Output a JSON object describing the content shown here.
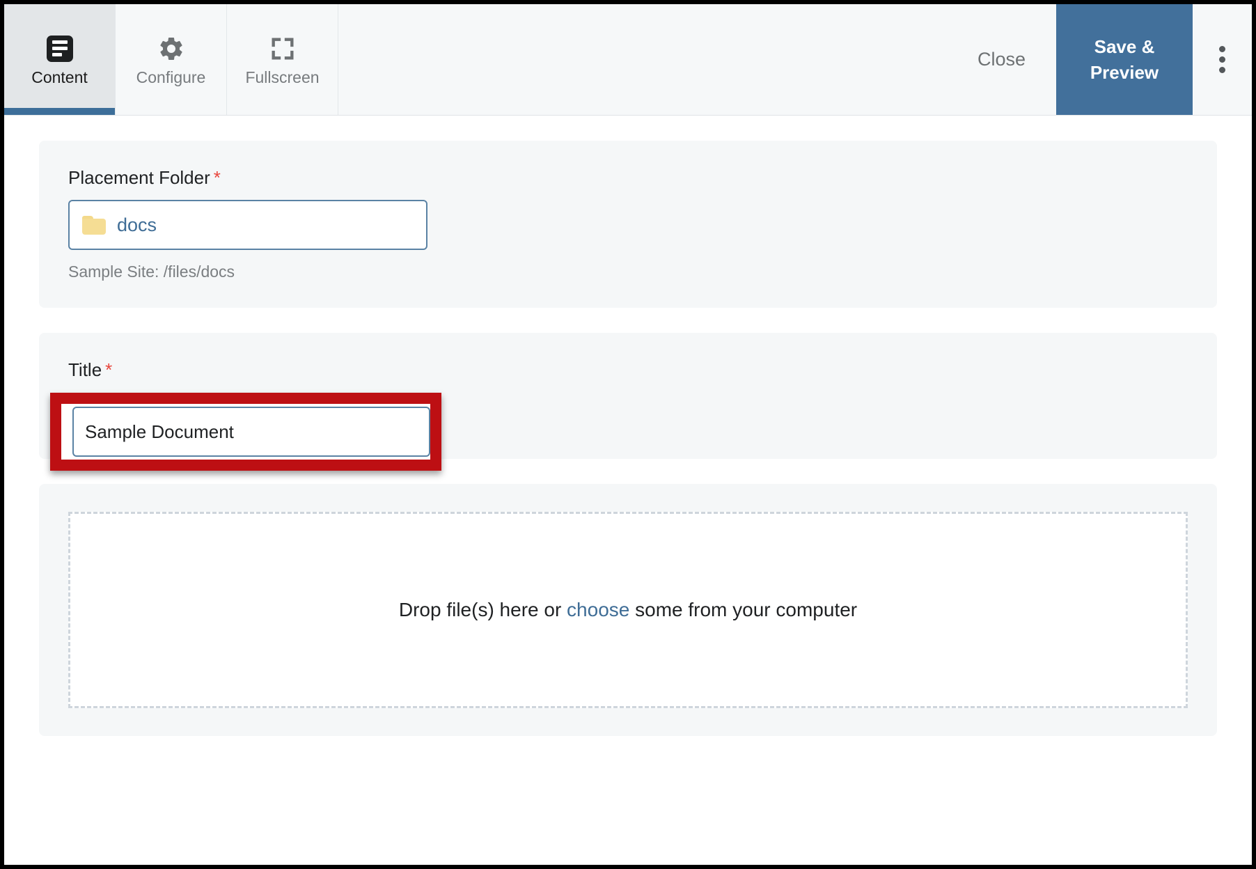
{
  "toolbar": {
    "tabs": [
      {
        "label": "Content",
        "icon": "content-lines-icon",
        "active": true
      },
      {
        "label": "Configure",
        "icon": "gear-icon",
        "active": false
      },
      {
        "label": "Fullscreen",
        "icon": "fullscreen-icon",
        "active": false
      }
    ],
    "close_label": "Close",
    "save_preview_label": "Save &\nPreview",
    "save_preview_line1": "Save &",
    "save_preview_line2": "Preview",
    "kebab_icon": "more-vertical-icon",
    "accent_color": "#42709b",
    "active_tab_underline_color": "#3d6e99"
  },
  "form": {
    "placement_folder": {
      "label": "Placement Folder",
      "required_marker": "*",
      "folder_icon": "folder-icon",
      "value": "docs",
      "helper_text": "Sample Site: /files/docs"
    },
    "title": {
      "label": "Title",
      "required_marker": "*",
      "value": "Sample Document",
      "placeholder": ""
    },
    "dropzone": {
      "text_before": "Drop file(s) here or ",
      "link_label": "choose",
      "text_after": " some from your computer"
    }
  },
  "annotation": {
    "highlight_color": "#bd0f13",
    "target": "title-input"
  }
}
